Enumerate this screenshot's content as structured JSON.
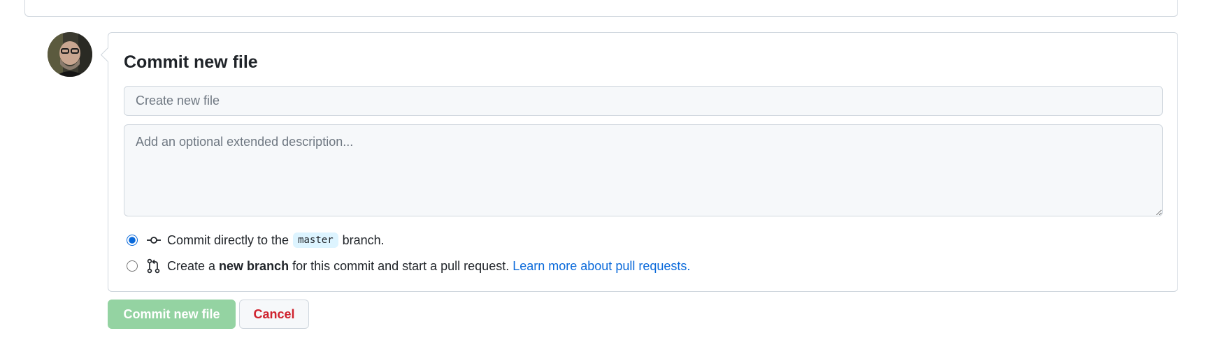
{
  "commit_form": {
    "title": "Commit new file",
    "summary": {
      "value": "",
      "placeholder": "Create new file"
    },
    "description": {
      "value": "",
      "placeholder": "Add an optional extended description..."
    },
    "options": {
      "direct": {
        "selected": true,
        "icon": "git-commit-icon",
        "text_before": "Commit directly to the",
        "branch": "master",
        "text_after": "branch."
      },
      "new_branch": {
        "selected": false,
        "icon": "git-pull-request-icon",
        "text_before": "Create a",
        "bold": "new branch",
        "text_after": "for this commit and start a pull request.",
        "link": "Learn more about pull requests."
      }
    }
  },
  "actions": {
    "commit_label": "Commit new file",
    "cancel_label": "Cancel"
  },
  "colors": {
    "link": "#0969da",
    "primary_button_disabled": "#94d3a2",
    "danger": "#cf222e",
    "branch_badge": "#ddf4ff"
  }
}
